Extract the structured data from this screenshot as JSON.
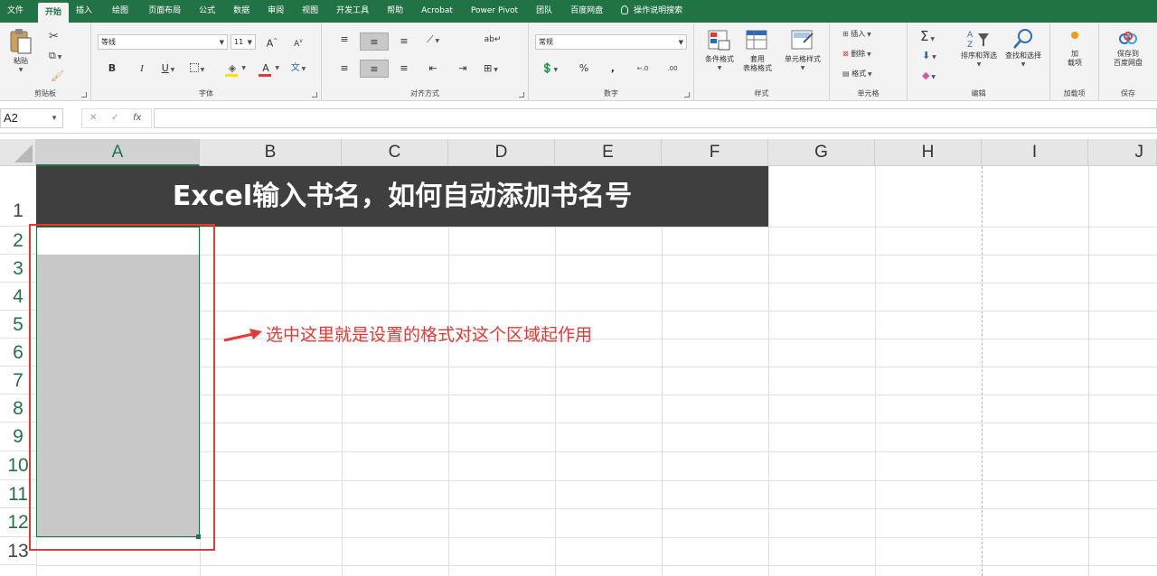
{
  "tabs": [
    {
      "label": "文件"
    },
    {
      "label": "开始",
      "active": true
    },
    {
      "label": "插入"
    },
    {
      "label": "绘图"
    },
    {
      "label": "页面布局"
    },
    {
      "label": "公式"
    },
    {
      "label": "数据"
    },
    {
      "label": "审阅"
    },
    {
      "label": "视图"
    },
    {
      "label": "开发工具"
    },
    {
      "label": "帮助"
    },
    {
      "label": "Acrobat"
    },
    {
      "label": "Power Pivot"
    },
    {
      "label": "团队"
    },
    {
      "label": "百度网盘"
    },
    {
      "label": "操作说明搜索"
    }
  ],
  "ribbon": {
    "clipboard": {
      "label": "剪贴板",
      "paste": "粘贴"
    },
    "font": {
      "label": "字体",
      "family": "等线",
      "size": "11",
      "bold": "B",
      "italic": "I",
      "underline": "U",
      "grow": "A",
      "shrink": "A",
      "color_letter": "A",
      "phonetic": "文"
    },
    "alignment": {
      "label": "对齐方式"
    },
    "number": {
      "label": "数字",
      "format": "常规",
      "percent": "%",
      "comma": ","
    },
    "styles": {
      "label": "样式",
      "conditional": "条件格式",
      "table_format_1": "套用",
      "table_format_2": "表格格式",
      "cell_styles": "单元格样式"
    },
    "cells": {
      "label": "单元格",
      "insert": "插入",
      "delete": "删除",
      "format": "格式"
    },
    "editing": {
      "label": "编辑",
      "sort_filter": "排序和筛选",
      "find_select": "查找和选择"
    },
    "addins": {
      "label": "加载项",
      "btn_1": "加",
      "btn_2": "载项"
    },
    "save": {
      "label": "保存",
      "btn_1": "保存到",
      "btn_2": "百度网盘"
    }
  },
  "formula_bar": {
    "name_box": "A2",
    "cancel": "✕",
    "enter": "✓",
    "fx": "fx",
    "content": ""
  },
  "columns": [
    "A",
    "B",
    "C",
    "D",
    "E",
    "F",
    "G",
    "H",
    "I",
    "J"
  ],
  "rows": [
    "1",
    "2",
    "3",
    "4",
    "5",
    "6",
    "7",
    "8",
    "9",
    "10",
    "11",
    "12",
    "13"
  ],
  "sheet": {
    "title": "Excel输入书名，如何自动添加书名号",
    "annotation": "选中这里就是设置的格式对这个区域起作用"
  },
  "colors": {
    "accent": "#217346",
    "highlight": "#e53935",
    "title_bg": "#3f3f3f",
    "selection": "#c8c8c8"
  }
}
